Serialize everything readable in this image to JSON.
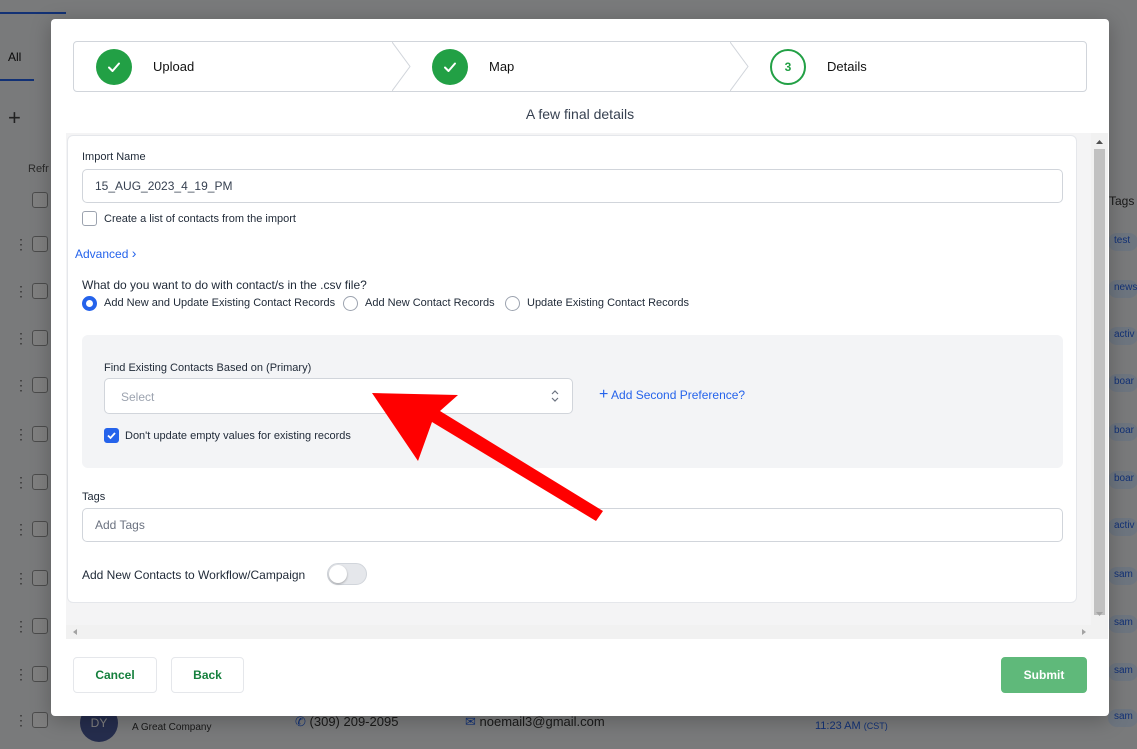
{
  "background": {
    "tab_all": "All",
    "refresh": "Refr",
    "tags_header": "Tags",
    "tag_chips": [
      "test",
      "news",
      "activ",
      "boar",
      "boar",
      "boar",
      "activ",
      "sam",
      "sam",
      "sam",
      "sam"
    ],
    "bottom_row": {
      "avatar_initials": "DY",
      "company": "A Great Company",
      "phone": "(309) 209-2095",
      "email": "noemail3@gmail.com",
      "time": "11:23 AM",
      "timezone": "(CST)"
    }
  },
  "modal": {
    "steps": [
      {
        "label": "Upload",
        "status": "done"
      },
      {
        "label": "Map",
        "status": "done"
      },
      {
        "label": "Details",
        "status": "current",
        "number": "3"
      }
    ],
    "subtitle": "A few final details",
    "import_name": {
      "label": "Import Name",
      "value": "15_AUG_2023_4_19_PM"
    },
    "create_list_label": "Create a list of contacts from the import",
    "create_list_checked": false,
    "advanced_label": "Advanced",
    "action_question": "What do you want to do with contact/s in the .csv file?",
    "action_options": [
      {
        "label": "Add New and Update Existing Contact Records",
        "selected": true
      },
      {
        "label": "Add New Contact Records",
        "selected": false
      },
      {
        "label": "Update Existing Contact Records",
        "selected": false
      }
    ],
    "find_existing": {
      "label": "Find Existing Contacts Based on (Primary)",
      "placeholder": "Select",
      "add_second": "Add Second Preference?",
      "dont_update_label": "Don't update empty values for existing records",
      "dont_update_checked": true
    },
    "tags": {
      "label": "Tags",
      "placeholder": "Add Tags"
    },
    "workflow_label": "Add New Contacts to Workflow/Campaign",
    "workflow_enabled": false,
    "buttons": {
      "cancel": "Cancel",
      "back": "Back",
      "submit": "Submit"
    }
  },
  "colors": {
    "success": "#22a045",
    "link": "#2563eb",
    "submit": "#5fb97a",
    "annotation_arrow": "#ff0000"
  }
}
